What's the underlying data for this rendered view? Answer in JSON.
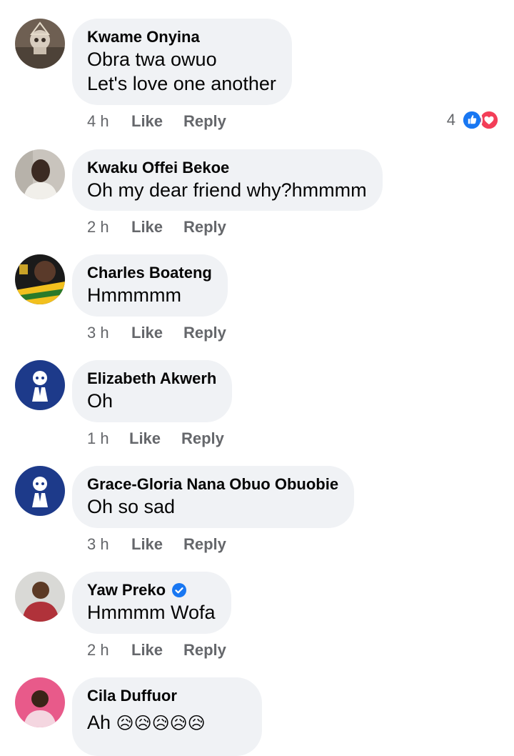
{
  "comments": [
    {
      "author": "Kwame Onyina",
      "lines": [
        "Obra twa owuo",
        "Let's love one another"
      ],
      "time": "4 h",
      "like_label": "Like",
      "reply_label": "Reply",
      "reaction_count": "4"
    },
    {
      "author": "Kwaku Offei Bekoe",
      "lines": [
        "Oh my dear friend why?hmmmm"
      ],
      "time": "2 h",
      "like_label": "Like",
      "reply_label": "Reply"
    },
    {
      "author": "Charles Boateng",
      "lines": [
        "Hmmmmm"
      ],
      "time": "3 h",
      "like_label": "Like",
      "reply_label": "Reply"
    },
    {
      "author": "Elizabeth Akwerh",
      "lines": [
        "Oh"
      ],
      "time": "1 h",
      "like_label": "Like",
      "reply_label": "Reply"
    },
    {
      "author": "Grace-Gloria Nana Obuo Obuobie",
      "lines": [
        "Oh so sad"
      ],
      "time": "3 h",
      "like_label": "Like",
      "reply_label": "Reply"
    },
    {
      "author": "Yaw Preko",
      "lines": [
        "Hmmmm Wofa"
      ],
      "time": "2 h",
      "like_label": "Like",
      "reply_label": "Reply"
    },
    {
      "author": "Cila Duffuor",
      "lines": [
        "Ah"
      ],
      "emoji": "😥😥😥😥😥"
    }
  ],
  "colors": {
    "bubble": "#f0f2f5",
    "meta_text": "#65676b",
    "like_blue": "#1877f2",
    "love_red": "#f33e58"
  },
  "icons": {
    "like_reaction": "like-thumb-icon",
    "love_reaction": "heart-icon",
    "verified": "verified-badge-icon"
  }
}
